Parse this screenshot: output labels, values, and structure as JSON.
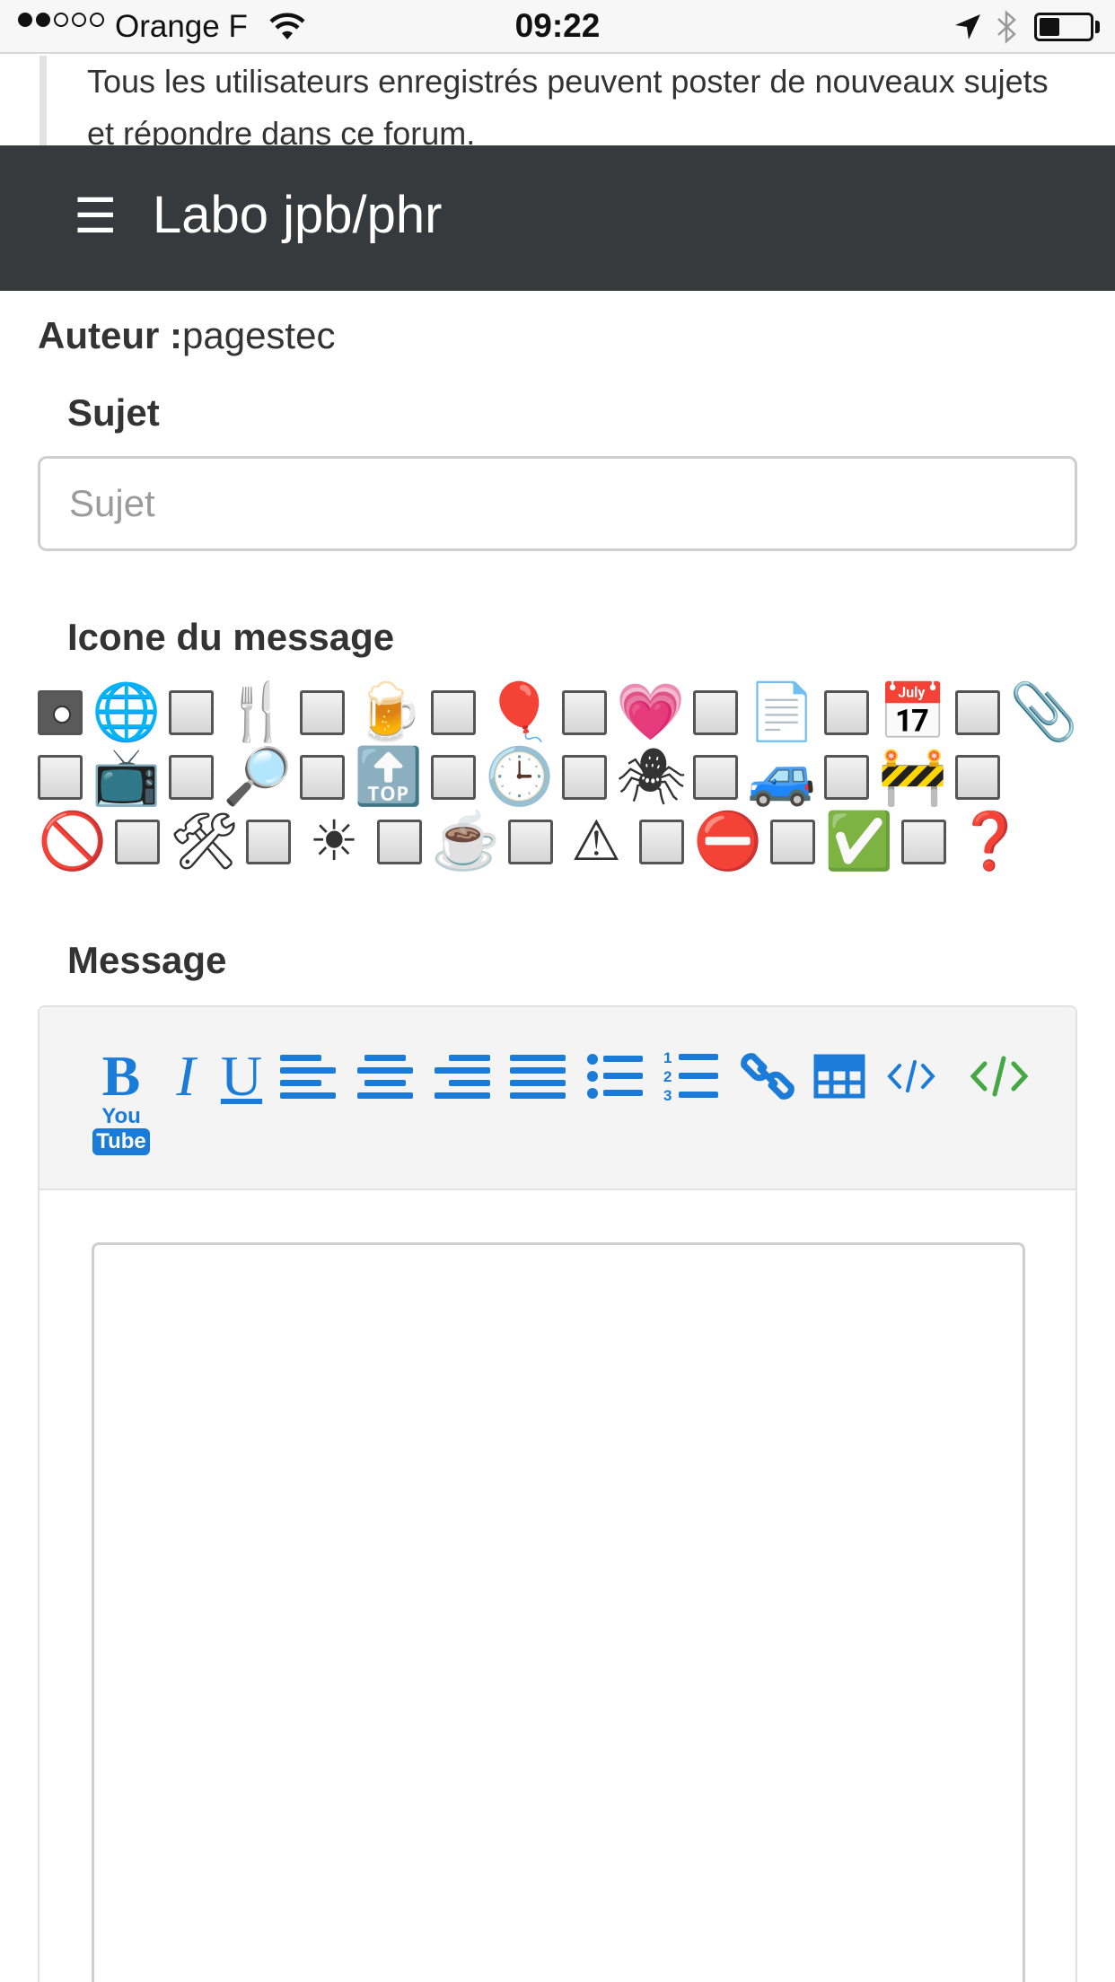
{
  "status_bar": {
    "carrier": "Orange F",
    "time": "09:22",
    "battery_level": 0.35
  },
  "info_text": "Tous les utilisateurs enregistrés peuvent poster de nouveaux sujets et répondre dans ce forum.",
  "nav": {
    "menu_icon": "☰",
    "title": "Labo jpb/phr"
  },
  "form": {
    "author_label": "Auteur :",
    "author_value": "pagestec",
    "subject_label": "Sujet",
    "subject_placeholder": "Sujet",
    "subject_value": "",
    "icon_label": "Icone du message",
    "message_label": "Message",
    "message_value": ""
  },
  "message_icons": [
    {
      "name": "globe-icon",
      "glyph": "🌐"
    },
    {
      "name": "fork-knife-icon",
      "glyph": "🍴"
    },
    {
      "name": "beer-icon",
      "glyph": "🍺"
    },
    {
      "name": "balloon-icon",
      "glyph": "🎈"
    },
    {
      "name": "heart-icon",
      "glyph": "💗"
    },
    {
      "name": "document-icon",
      "glyph": "📄"
    },
    {
      "name": "calendar-icon",
      "glyph": "📅"
    },
    {
      "name": "paperclip-icon",
      "glyph": "📎"
    },
    {
      "name": "tv-icon",
      "glyph": "📺"
    },
    {
      "name": "magnifier-icon",
      "glyph": "🔎"
    },
    {
      "name": "top-arrow-icon",
      "glyph": "🔝"
    },
    {
      "name": "clock-icon",
      "glyph": "🕒"
    },
    {
      "name": "spider-icon",
      "glyph": "🕷"
    },
    {
      "name": "car-icon",
      "glyph": "🚙"
    },
    {
      "name": "construction-icon",
      "glyph": "🚧"
    },
    {
      "name": "prohibited-icon",
      "glyph": "🚫"
    },
    {
      "name": "tools-icon",
      "glyph": "🛠"
    },
    {
      "name": "sun-icon",
      "glyph": "☀"
    },
    {
      "name": "coffee-icon",
      "glyph": "☕"
    },
    {
      "name": "warning-icon",
      "glyph": "⚠"
    },
    {
      "name": "no-entry-icon",
      "glyph": "⛔"
    },
    {
      "name": "check-icon",
      "glyph": "✅"
    },
    {
      "name": "question-icon",
      "glyph": "❓"
    }
  ],
  "selected_icon_index": 0,
  "toolbar": {
    "bold": "B",
    "italic": "I",
    "underline": "U",
    "youtube_top": "You",
    "youtube_bottom": "Tube",
    "accent_color": "#1a7bd8",
    "source_color": "#45a845"
  }
}
